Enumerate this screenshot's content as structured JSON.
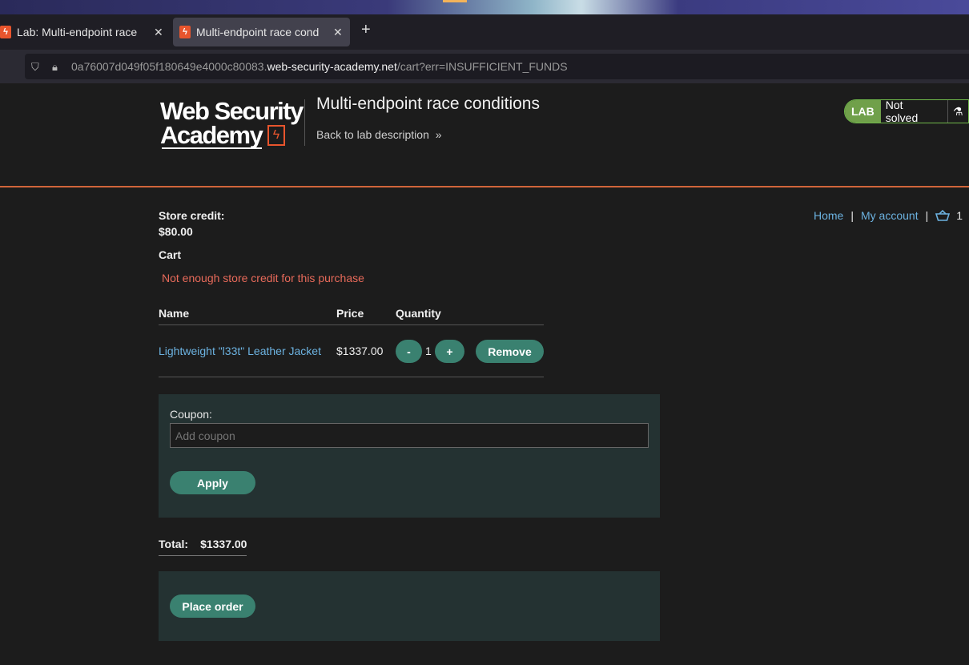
{
  "browser": {
    "tabs": [
      {
        "label": "Lab: Multi-endpoint race",
        "favicon": "burp-icon"
      },
      {
        "label": "Multi-endpoint race cond",
        "favicon": "burp-icon"
      }
    ],
    "url_prefix": "0a76007d049f05f180649e4000c80083.",
    "url_domain": "web-security-academy.net",
    "url_path": "/cart?err=INSUFFICIENT_FUNDS"
  },
  "header": {
    "logo_line1": "Web Security",
    "logo_line2": "Academy",
    "lab_title": "Multi-endpoint race conditions",
    "back_link": "Back to lab description",
    "badge_lab": "LAB",
    "badge_status": "Not solved"
  },
  "nav": {
    "home": "Home",
    "separator": "|",
    "account": "My account",
    "cart_count": "1"
  },
  "cart": {
    "credit_label": "Store credit:",
    "credit_value": "$80.00",
    "heading": "Cart",
    "error": "Not enough store credit for this purchase",
    "columns": [
      "Name",
      "Price",
      "Quantity"
    ],
    "item": {
      "name": "Lightweight \"l33t\" Leather Jacket",
      "price": "$1337.00",
      "quantity": "1"
    },
    "minus_label": "-",
    "plus_label": "+",
    "remove_label": "Remove",
    "coupon_label": "Coupon:",
    "coupon_placeholder": "Add coupon",
    "apply_label": "Apply",
    "total_label": "Total:",
    "total_value": "$1337.00",
    "place_order_label": "Place order"
  },
  "colors": {
    "accent": "#3a8170",
    "link": "#6cb2e0",
    "error": "#e86a5a",
    "header_rule": "#d0653a"
  }
}
